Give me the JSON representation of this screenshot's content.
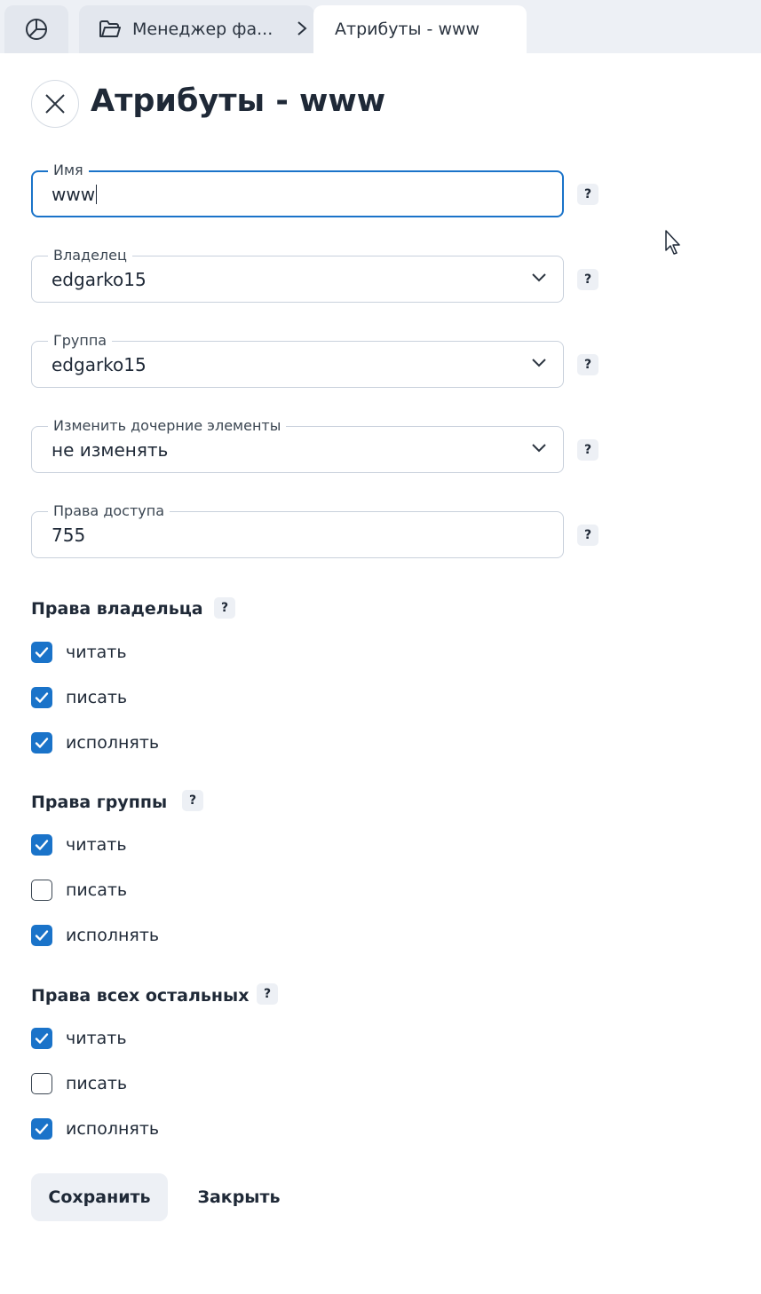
{
  "tabs": {
    "home_icon": "pie-chart-icon",
    "file_manager": "Менеджер фа...",
    "active": "Атрибуты - www"
  },
  "page": {
    "title": "Атрибуты - www"
  },
  "fields": {
    "name": {
      "label": "Имя",
      "value": "www"
    },
    "owner": {
      "label": "Владелец",
      "value": "edgarko15"
    },
    "group": {
      "label": "Группа",
      "value": "edgarko15"
    },
    "children": {
      "label": "Изменить дочерние элементы",
      "value": "не изменять"
    },
    "permissions": {
      "label": "Права доступа",
      "value": "755"
    }
  },
  "help_label": "?",
  "sections": {
    "owner": {
      "title": "Права владельца",
      "items": [
        {
          "label": "читать",
          "checked": true
        },
        {
          "label": "писать",
          "checked": true
        },
        {
          "label": "исполнять",
          "checked": true
        }
      ]
    },
    "group": {
      "title": "Права группы",
      "items": [
        {
          "label": "читать",
          "checked": true
        },
        {
          "label": "писать",
          "checked": false
        },
        {
          "label": "исполнять",
          "checked": true
        }
      ]
    },
    "others": {
      "title": "Права всех остальных",
      "items": [
        {
          "label": "читать",
          "checked": true
        },
        {
          "label": "писать",
          "checked": false
        },
        {
          "label": "исполнять",
          "checked": true
        }
      ]
    }
  },
  "buttons": {
    "save": "Сохранить",
    "close": "Закрыть"
  },
  "colors": {
    "accent": "#1a73c9",
    "tab_bg": "#e3e7ee",
    "bar_bg": "#edf0f5"
  }
}
